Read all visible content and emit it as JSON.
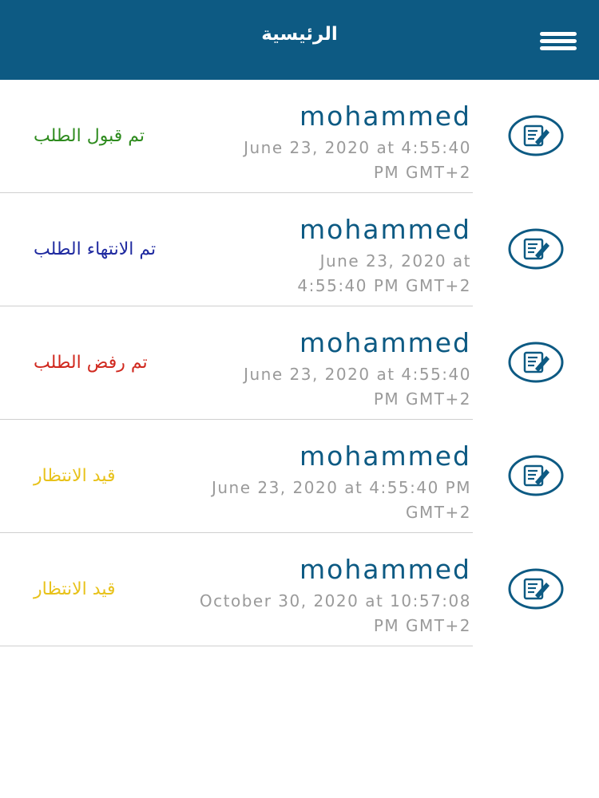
{
  "header": {
    "title": "الرئيسية",
    "menu_icon": "hamburger-menu-icon"
  },
  "colors": {
    "header_bg": "#0d5a83",
    "name": "#0d5a83",
    "date": "#9a9a9a",
    "accepted": "#2e8b1e",
    "finished": "#1f2aa0",
    "rejected": "#d0281e",
    "pending": "#e8c21b"
  },
  "requests": [
    {
      "name": "mohammed",
      "date_line1": "June 23, 2020 at 4:55:40",
      "date_line2": "PM GMT+2",
      "status": "تم قبول الطلب",
      "status_color": "#2e8b1e",
      "icon": "edit-document-icon"
    },
    {
      "name": "mohammed",
      "date_line1": "June 23, 2020 at",
      "date_line2": "4:55:40 PM GMT+2",
      "status": "تم الانتهاء الطلب",
      "status_color": "#1f2aa0",
      "icon": "edit-document-icon"
    },
    {
      "name": "mohammed",
      "date_line1": "June 23, 2020 at 4:55:40",
      "date_line2": "PM GMT+2",
      "status": "تم رفض الطلب",
      "status_color": "#d0281e",
      "icon": "edit-document-icon"
    },
    {
      "name": "mohammed",
      "date_line1": "June 23, 2020 at 4:55:40 PM",
      "date_line2": "GMT+2",
      "status": "قيد الانتظار",
      "status_color": "#e8c21b",
      "icon": "edit-document-icon"
    },
    {
      "name": "mohammed",
      "date_line1": "October 30, 2020 at 10:57:08",
      "date_line2": "PM GMT+2",
      "status": "قيد الانتظار",
      "status_color": "#e8c21b",
      "icon": "edit-document-icon"
    }
  ]
}
